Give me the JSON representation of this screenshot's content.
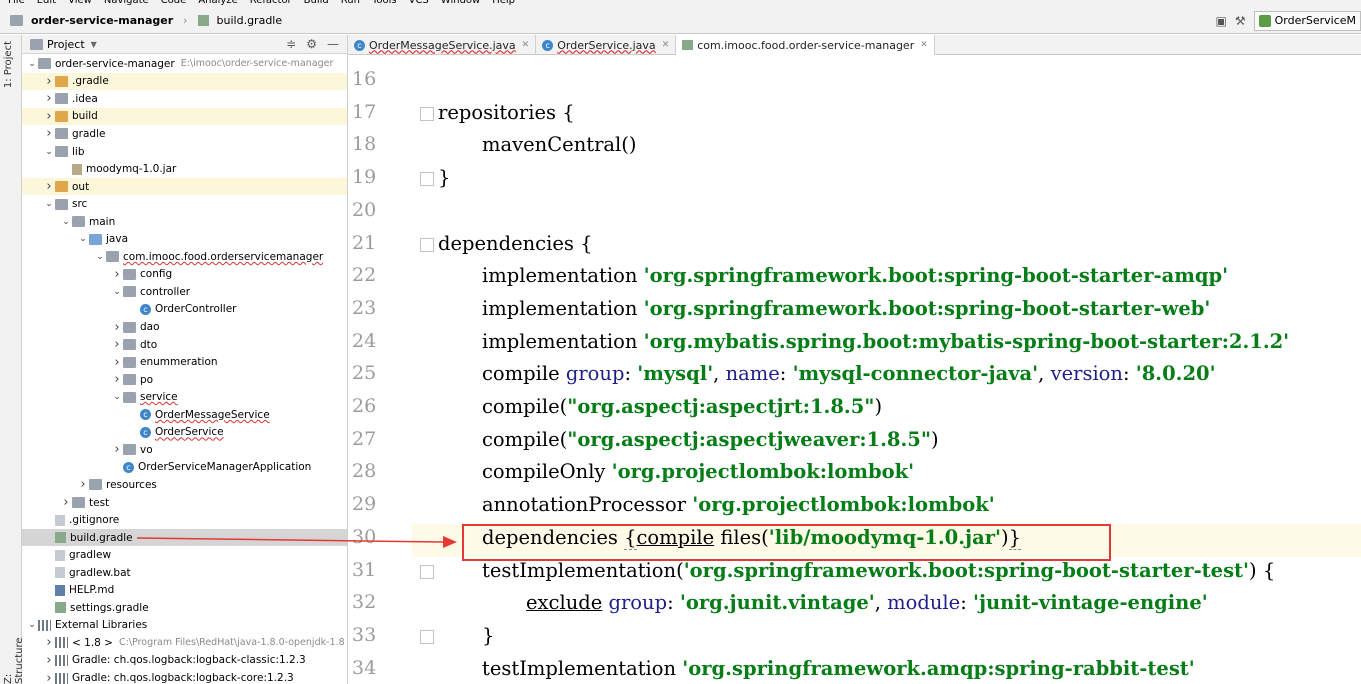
{
  "menu": [
    "File",
    "Edit",
    "View",
    "Navigate",
    "Code",
    "Analyze",
    "Refactor",
    "Build",
    "Run",
    "Tools",
    "VCS",
    "Window",
    "Help"
  ],
  "navbar": {
    "project": "order-service-manager",
    "file": "build.gradle",
    "run_config": "OrderServiceM"
  },
  "left_toolbar": {
    "project_tab": "1: Project",
    "structure_tab": "Z: Structure"
  },
  "project_panel": {
    "title": "Project",
    "tree": [
      {
        "label": "order-service-manager",
        "path": "E:\\imooc\\order-service-manager",
        "depth": 0,
        "arrow": "open",
        "icon": "folder grey"
      },
      {
        "label": ".gradle",
        "depth": 1,
        "arrow": "closed",
        "icon": "folder orange",
        "hl": true
      },
      {
        "label": ".idea",
        "depth": 1,
        "arrow": "closed",
        "icon": "folder grey"
      },
      {
        "label": "build",
        "depth": 1,
        "arrow": "closed",
        "icon": "folder orange",
        "hl": true
      },
      {
        "label": "gradle",
        "depth": 1,
        "arrow": "closed",
        "icon": "folder grey"
      },
      {
        "label": "lib",
        "depth": 1,
        "arrow": "open",
        "icon": "folder grey"
      },
      {
        "label": "moodymq-1.0.jar",
        "depth": 2,
        "arrow": "none",
        "icon": "jar"
      },
      {
        "label": "out",
        "depth": 1,
        "arrow": "closed",
        "icon": "folder orange",
        "hl": true
      },
      {
        "label": "src",
        "depth": 1,
        "arrow": "open",
        "icon": "folder grey"
      },
      {
        "label": "main",
        "depth": 2,
        "arrow": "open",
        "icon": "folder grey"
      },
      {
        "label": "java",
        "depth": 3,
        "arrow": "open",
        "icon": "folder blue"
      },
      {
        "label": "com.imooc.food.orderservicemanager",
        "depth": 4,
        "arrow": "open",
        "icon": "folder grey",
        "squiggle": true
      },
      {
        "label": "config",
        "depth": 5,
        "arrow": "closed",
        "icon": "folder grey"
      },
      {
        "label": "controller",
        "depth": 5,
        "arrow": "open",
        "icon": "folder grey"
      },
      {
        "label": "OrderController",
        "depth": 6,
        "arrow": "none",
        "icon": "cls"
      },
      {
        "label": "dao",
        "depth": 5,
        "arrow": "closed",
        "icon": "folder grey"
      },
      {
        "label": "dto",
        "depth": 5,
        "arrow": "closed",
        "icon": "folder grey"
      },
      {
        "label": "enummeration",
        "depth": 5,
        "arrow": "closed",
        "icon": "folder grey"
      },
      {
        "label": "po",
        "depth": 5,
        "arrow": "closed",
        "icon": "folder grey"
      },
      {
        "label": "service",
        "depth": 5,
        "arrow": "open",
        "icon": "folder grey",
        "squiggle": true
      },
      {
        "label": "OrderMessageService",
        "depth": 6,
        "arrow": "none",
        "icon": "cls",
        "squiggle": true
      },
      {
        "label": "OrderService",
        "depth": 6,
        "arrow": "none",
        "icon": "cls",
        "squiggle": true
      },
      {
        "label": "vo",
        "depth": 5,
        "arrow": "closed",
        "icon": "folder grey"
      },
      {
        "label": "OrderServiceManagerApplication",
        "depth": 5,
        "arrow": "none",
        "icon": "cls"
      },
      {
        "label": "resources",
        "depth": 3,
        "arrow": "closed",
        "icon": "folder grey"
      },
      {
        "label": "test",
        "depth": 2,
        "arrow": "closed",
        "icon": "folder grey"
      },
      {
        "label": ".gitignore",
        "depth": 1,
        "arrow": "none",
        "icon": "file"
      },
      {
        "label": "build.gradle",
        "depth": 1,
        "arrow": "none",
        "icon": "gradle",
        "sel": true
      },
      {
        "label": "gradlew",
        "depth": 1,
        "arrow": "none",
        "icon": "file"
      },
      {
        "label": "gradlew.bat",
        "depth": 1,
        "arrow": "none",
        "icon": "file"
      },
      {
        "label": "HELP.md",
        "depth": 1,
        "arrow": "none",
        "icon": "md"
      },
      {
        "label": "settings.gradle",
        "depth": 1,
        "arrow": "none",
        "icon": "gradle"
      },
      {
        "label": "External Libraries",
        "depth": 0,
        "arrow": "open",
        "icon": "lib"
      },
      {
        "label": "< 1.8 >",
        "path": "C:\\Program Files\\RedHat\\java-1.8.0-openjdk-1.8",
        "depth": 1,
        "arrow": "closed",
        "icon": "lib"
      },
      {
        "label": "Gradle: ch.qos.logback:logback-classic:1.2.3",
        "depth": 1,
        "arrow": "closed",
        "icon": "lib"
      },
      {
        "label": "Gradle: ch.qos.logback:logback-core:1.2.3",
        "depth": 1,
        "arrow": "closed",
        "icon": "lib"
      }
    ]
  },
  "tabs": [
    {
      "label": "OrderMessageService.java",
      "type": "class",
      "active": false
    },
    {
      "label": "OrderService.java",
      "type": "class",
      "active": false
    },
    {
      "label": "com.imooc.food.order-service-manager",
      "type": "gradle",
      "active": true
    }
  ],
  "editor": {
    "lines": [
      {
        "n": "16",
        "html": ""
      },
      {
        "n": "17",
        "html": "repositories {",
        "indent": 0,
        "fold": true
      },
      {
        "n": "18",
        "html": "mavenCentral()",
        "indent": 1
      },
      {
        "n": "19",
        "html": "}",
        "indent": 0,
        "fold": true
      },
      {
        "n": "20",
        "html": ""
      },
      {
        "n": "21",
        "html": "dependencies {",
        "indent": 0,
        "fold": true
      },
      {
        "n": "22",
        "parts": [
          [
            "implementation ",
            ""
          ],
          [
            "'org.springframework.boot:spring-boot-starter-amqp'",
            "s"
          ]
        ],
        "indent": 1
      },
      {
        "n": "23",
        "parts": [
          [
            "implementation ",
            ""
          ],
          [
            "'org.springframework.boot:spring-boot-starter-web'",
            "s"
          ]
        ],
        "indent": 1
      },
      {
        "n": "24",
        "parts": [
          [
            "implementation ",
            ""
          ],
          [
            "'org.mybatis.spring.boot:mybatis-spring-boot-starter:2.1.2'",
            "s"
          ]
        ],
        "indent": 1
      },
      {
        "n": "25",
        "parts": [
          [
            "compile ",
            ""
          ],
          [
            "group",
            "k"
          ],
          [
            ": ",
            ""
          ],
          [
            "'mysql'",
            "s"
          ],
          [
            ", ",
            ""
          ],
          [
            "name",
            "k"
          ],
          [
            ": ",
            ""
          ],
          [
            "'mysql-connector-java'",
            "s"
          ],
          [
            ", ",
            ""
          ],
          [
            "version",
            "k"
          ],
          [
            ": ",
            ""
          ],
          [
            "'8.0.20'",
            "s"
          ]
        ],
        "indent": 1
      },
      {
        "n": "26",
        "parts": [
          [
            "compile(",
            ""
          ],
          [
            "\"org.aspectj:aspectjrt:1.8.5\"",
            "s"
          ],
          [
            ")",
            ""
          ]
        ],
        "indent": 1
      },
      {
        "n": "27",
        "parts": [
          [
            "compile(",
            ""
          ],
          [
            "\"org.aspectj:aspectjweaver:1.8.5\"",
            "s"
          ],
          [
            ")",
            ""
          ]
        ],
        "indent": 1
      },
      {
        "n": "28",
        "parts": [
          [
            "compileOnly ",
            ""
          ],
          [
            "'org.projectlombok:lombok'",
            "s"
          ]
        ],
        "indent": 1
      },
      {
        "n": "29",
        "parts": [
          [
            "annotationProcessor ",
            ""
          ],
          [
            "'org.projectlombok:lombok'",
            "s"
          ]
        ],
        "indent": 1
      },
      {
        "n": "30",
        "parts": [
          [
            "dependencies ",
            ""
          ],
          [
            "{",
            "dline"
          ],
          [
            "compile",
            "uline"
          ],
          [
            " files(",
            ""
          ],
          [
            "'lib/moodymq-1.0.jar'",
            "s"
          ],
          [
            ")",
            ""
          ],
          [
            "}",
            "dline"
          ]
        ],
        "indent": 1
      },
      {
        "n": "31",
        "parts": [
          [
            "testImplementation(",
            ""
          ],
          [
            "'org.springframework.boot:spring-boot-starter-test'",
            "s"
          ],
          [
            ") {",
            ""
          ]
        ],
        "indent": 1,
        "fold": true
      },
      {
        "n": "32",
        "parts": [
          [
            "exclude",
            "uline"
          ],
          [
            " ",
            ""
          ],
          [
            "group",
            "k"
          ],
          [
            ": ",
            ""
          ],
          [
            "'org.junit.vintage'",
            "s"
          ],
          [
            ", ",
            ""
          ],
          [
            "module",
            "k"
          ],
          [
            ": ",
            ""
          ],
          [
            "'junit-vintage-engine'",
            "s"
          ]
        ],
        "indent": 2
      },
      {
        "n": "33",
        "html": "}",
        "indent": 1,
        "fold": true
      },
      {
        "n": "34",
        "parts": [
          [
            "testImplementation ",
            ""
          ],
          [
            "'org.springframework.amqp:spring-rabbit-test'",
            "s"
          ]
        ],
        "indent": 1
      }
    ]
  },
  "colors": {
    "annotation": "#e53935",
    "string": "#067d17",
    "keyword": "#1f1f8a"
  }
}
